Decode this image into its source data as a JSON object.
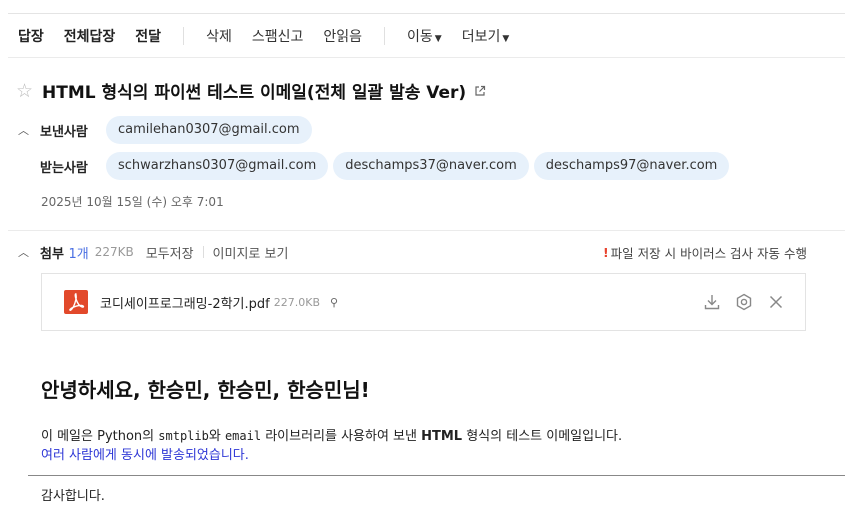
{
  "toolbar": {
    "reply": "답장",
    "reply_all": "전체답장",
    "forward": "전달",
    "delete": "삭제",
    "report_spam": "스팸신고",
    "mark_unread": "안읽음",
    "move": "이동",
    "more": "더보기"
  },
  "subject": "HTML 형식의 파이썬 테스트 이메일(전체 일괄 발송 Ver)",
  "sender": {
    "label": "보낸사람",
    "address": "camilehan0307@gmail.com"
  },
  "recipients": {
    "label": "받는사람",
    "addresses": [
      "schwarzhans0307@gmail.com",
      "deschamps37@naver.com",
      "deschamps97@naver.com"
    ]
  },
  "date": "2025년 10월 15일 (수) 오후 7:01",
  "attachments": {
    "label": "첨부",
    "count": "1개",
    "total_size": "227KB",
    "save_all": "모두저장",
    "view_as_image": "이미지로 보기",
    "virus_scan_note": "파일 저장 시 바이러스 검사 자동 수행",
    "file": {
      "name": "코디세이프로그래밍-2학기.pdf",
      "size": "227.0KB",
      "icon": "pdf-icon"
    }
  },
  "body": {
    "greeting": "안녕하세요, 한승민, 한승민, 한승민님!",
    "line1_a": "이 메일은 Python의 ",
    "line1_code1": "smtplib",
    "line1_b": "와 ",
    "line1_code2": "email",
    "line1_c": " 라이브러리를 사용하여 보낸 ",
    "line1_bold": "HTML",
    "line1_d": " 형식의 테스트 이메일입니다.",
    "line2": "여러 사람에게 동시에 발송되었습니다.",
    "closing": "감사합니다."
  },
  "colors": {
    "chip_bg": "#e7f1fb",
    "link_blue": "#2e37d6",
    "count_blue": "#4a6fe3",
    "warning_red": "#e8432e",
    "pdf_red": "#e2492b"
  }
}
